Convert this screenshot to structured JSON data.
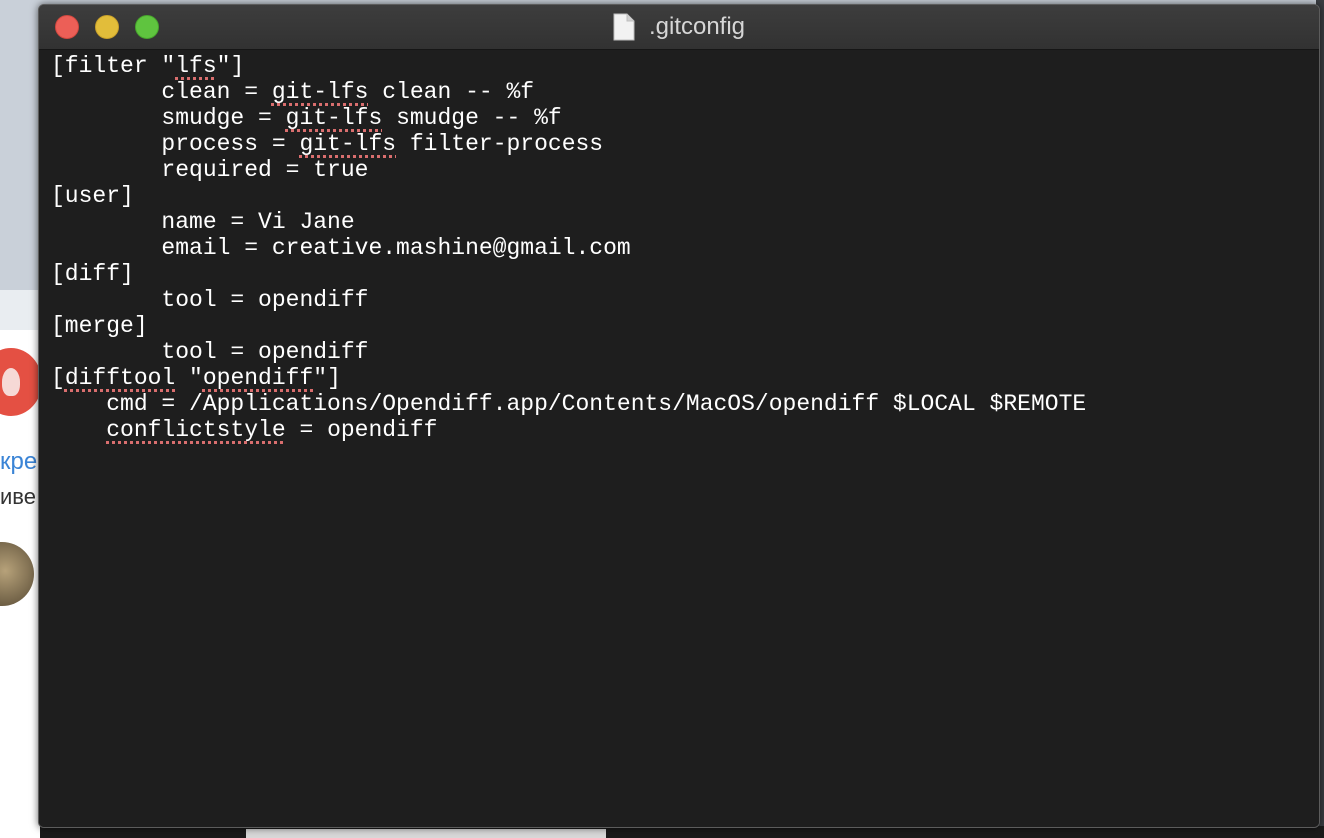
{
  "window": {
    "title": ".gitconfig",
    "title_icon": "document-icon"
  },
  "background": {
    "text1": "кре",
    "text2": "иве"
  },
  "editor": {
    "lines": [
      [
        {
          "t": "[filter \""
        },
        {
          "t": "lfs",
          "s": true
        },
        {
          "t": "\"]"
        }
      ],
      [
        {
          "t": "        clean = "
        },
        {
          "t": "git-lfs",
          "s": true
        },
        {
          "t": " clean -- %f"
        }
      ],
      [
        {
          "t": "        smudge = "
        },
        {
          "t": "git-lfs",
          "s": true
        },
        {
          "t": " smudge -- %f"
        }
      ],
      [
        {
          "t": "        process = "
        },
        {
          "t": "git-lfs",
          "s": true
        },
        {
          "t": " filter-process"
        }
      ],
      [
        {
          "t": "        required = true"
        }
      ],
      [
        {
          "t": "[user]"
        }
      ],
      [
        {
          "t": "        name = Vi Jane"
        }
      ],
      [
        {
          "t": "        email = creative.mashine@gmail.com"
        }
      ],
      [
        {
          "t": "[diff]"
        }
      ],
      [
        {
          "t": "        tool = opendiff"
        }
      ],
      [
        {
          "t": "[merge]"
        }
      ],
      [
        {
          "t": "        tool = opendiff"
        }
      ],
      [
        {
          "t": "["
        },
        {
          "t": "difftool",
          "s": true
        },
        {
          "t": " \""
        },
        {
          "t": "opendiff",
          "s": true
        },
        {
          "t": "\"]"
        }
      ],
      [
        {
          "t": "    cmd = /Applications/Opendiff.app/Contents/MacOS/opendiff $LOCAL $REMOTE"
        }
      ],
      [
        {
          "t": "    "
        },
        {
          "t": "conflictstyle",
          "s": true
        },
        {
          "t": " = opendiff"
        }
      ]
    ]
  },
  "colors": {
    "editor_bg": "#1e1e1e",
    "text": "#ffffff",
    "spellcheck": "#d96e6e"
  }
}
